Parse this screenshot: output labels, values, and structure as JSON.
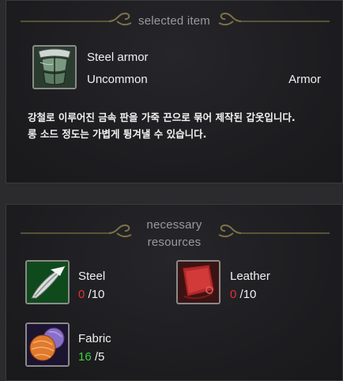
{
  "selected": {
    "section_title": "selected item",
    "icon": "steel-armor-icon",
    "name": "Steel armor",
    "rarity": "Uncommon",
    "type": "Armor",
    "description_line1": "강철로 이루어진 금속 판을 가죽 끈으로 묶어 제작된 갑옷입니다.",
    "description_line2": "롱 소드 정도는 가볍게 튕겨낼 수 있습니다."
  },
  "resources": {
    "section_title_line1": "necessary",
    "section_title_line2": "resources",
    "items": [
      {
        "name": "Steel",
        "icon": "steel-icon",
        "have": "0",
        "separator": "/",
        "need": "10",
        "status_color": "#e83030"
      },
      {
        "name": "Leather",
        "icon": "leather-icon",
        "have": "0",
        "separator": "/",
        "need": "10",
        "status_color": "#e83030"
      },
      {
        "name": "Fabric",
        "icon": "fabric-icon",
        "have": "16",
        "separator": "/",
        "need": "5",
        "status_color": "#3ccf3c"
      }
    ]
  },
  "colors": {
    "ornament": "#7d7346",
    "insufficient": "#e83030",
    "sufficient": "#3ccf3c"
  }
}
